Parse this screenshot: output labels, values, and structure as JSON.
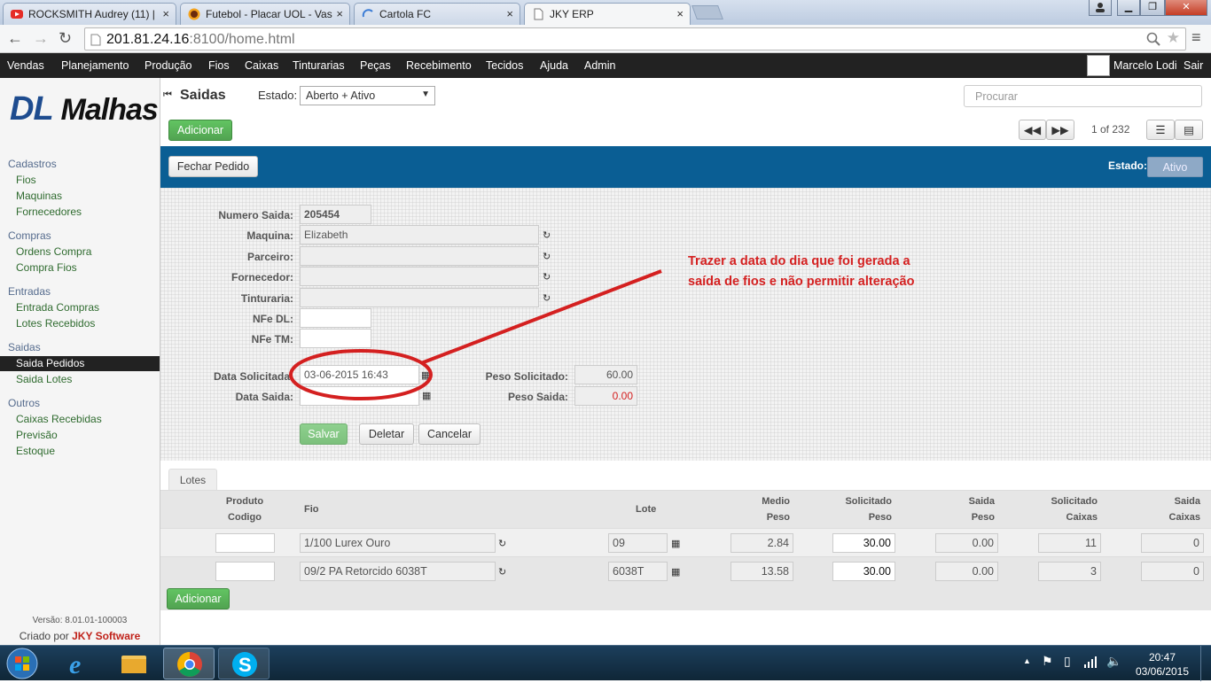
{
  "browser": {
    "tabs": [
      {
        "title": "ROCKSMITH Audrey (11) |",
        "icon": "youtube-icon",
        "close": "×"
      },
      {
        "title": "Futebol - Placar UOL - Vas",
        "icon": "uol-icon",
        "close": "×"
      },
      {
        "title": "Cartola FC",
        "icon": "loading-icon",
        "close": "×"
      },
      {
        "title": "JKY ERP",
        "icon": "page-icon",
        "close": "×"
      }
    ],
    "url_host": "201.81.24.16",
    "url_rest": ":8100/home.html"
  },
  "menu": {
    "items": [
      "Vendas",
      "Planejamento",
      "Produção",
      "Fios",
      "Caixas",
      "Tinturarias",
      "Peças",
      "Recebimento",
      "Tecidos",
      "Ajuda",
      "Admin"
    ],
    "active": "Fios",
    "user": "Marcelo Lodi",
    "logout": "Sair"
  },
  "sidebar": {
    "logo_dl": "DL",
    "logo_malhas": "Malhas",
    "groups": [
      {
        "title": "Cadastros",
        "items": [
          "Fios",
          "Maquinas",
          "Fornecedores"
        ]
      },
      {
        "title": "Compras",
        "items": [
          "Ordens Compra",
          "Compra Fios"
        ]
      },
      {
        "title": "Entradas",
        "items": [
          "Entrada Compras",
          "Lotes Recebidos"
        ]
      },
      {
        "title": "Saidas",
        "items": [
          "Saida Pedidos",
          "Saida Lotes"
        ]
      },
      {
        "title": "Outros",
        "items": [
          "Caixas Recebidas",
          "Previsão",
          "Estoque"
        ]
      }
    ],
    "selected": "Saida Pedidos",
    "version": "Versão: 8.01.01-100003",
    "created_by": "Criado por",
    "company": "JKY Software"
  },
  "header": {
    "title": "Saidas",
    "estado_label": "Estado:",
    "estado_value": "Aberto + Ativo",
    "search_placeholder": "Procurar",
    "add_label": "Adicionar",
    "pager": "1 of 232"
  },
  "bluebar": {
    "fechar_label": "Fechar Pedido",
    "estado_label": "Estado:",
    "estado_value": "Ativo"
  },
  "form": {
    "numero_saida_label": "Numero Saida:",
    "numero_saida": "205454",
    "maquina_label": "Maquina:",
    "maquina": "Elizabeth",
    "parceiro_label": "Parceiro:",
    "parceiro": "",
    "fornecedor_label": "Fornecedor:",
    "fornecedor": "",
    "tinturaria_label": "Tinturaria:",
    "tinturaria": "",
    "nfe_dl_label": "NFe DL:",
    "nfe_dl": "",
    "nfe_tm_label": "NFe TM:",
    "nfe_tm": "",
    "data_solicitada_label": "Data Solicitada:",
    "data_solicitada": "03-06-2015 16:43",
    "data_saida_label": "Data Saida:",
    "data_saida": "",
    "peso_solicitado_label": "Peso Solicitado:",
    "peso_solicitado": "60.00",
    "peso_saida_label": "Peso Saida:",
    "peso_saida": "0.00",
    "salvar_label": "Salvar",
    "deletar_label": "Deletar",
    "cancelar_label": "Cancelar",
    "annotation_line1": "Trazer a data do dia que foi gerada a",
    "annotation_line2": "saída de fios e não permitir alteração"
  },
  "lotes": {
    "tab_label": "Lotes",
    "headers": [
      [
        "Produto",
        "Codigo"
      ],
      [
        "",
        "Fio"
      ],
      [
        "",
        "Lote"
      ],
      [
        "Medio",
        "Peso"
      ],
      [
        "Solicitado",
        "Peso"
      ],
      [
        "Saida",
        "Peso"
      ],
      [
        "Solicitado",
        "Caixas"
      ],
      [
        "Saida",
        "Caixas"
      ]
    ],
    "rows": [
      {
        "codigo": "",
        "fio": "1/100 Lurex Ouro",
        "lote": "09",
        "medio_peso": "2.84",
        "solicitado_peso": "30.00",
        "saida_peso": "0.00",
        "solicitado_caixas": "11",
        "saida_caixas": "0"
      },
      {
        "codigo": "",
        "fio": "09/2 PA Retorcido 6038T",
        "lote": "6038T",
        "medio_peso": "13.58",
        "solicitado_peso": "30.00",
        "saida_peso": "0.00",
        "solicitado_caixas": "3",
        "saida_caixas": "0"
      }
    ],
    "add_label": "Adicionar"
  },
  "taskbar": {
    "time": "20:47",
    "date": "03/06/2015",
    "apps": [
      "start-orb-icon",
      "internet-explorer-icon",
      "file-explorer-icon",
      "chrome-icon",
      "skype-icon"
    ]
  },
  "colors": {
    "accent_blue": "#0a5e94",
    "annotation_red": "#d42020",
    "button_green": "#51a351"
  }
}
